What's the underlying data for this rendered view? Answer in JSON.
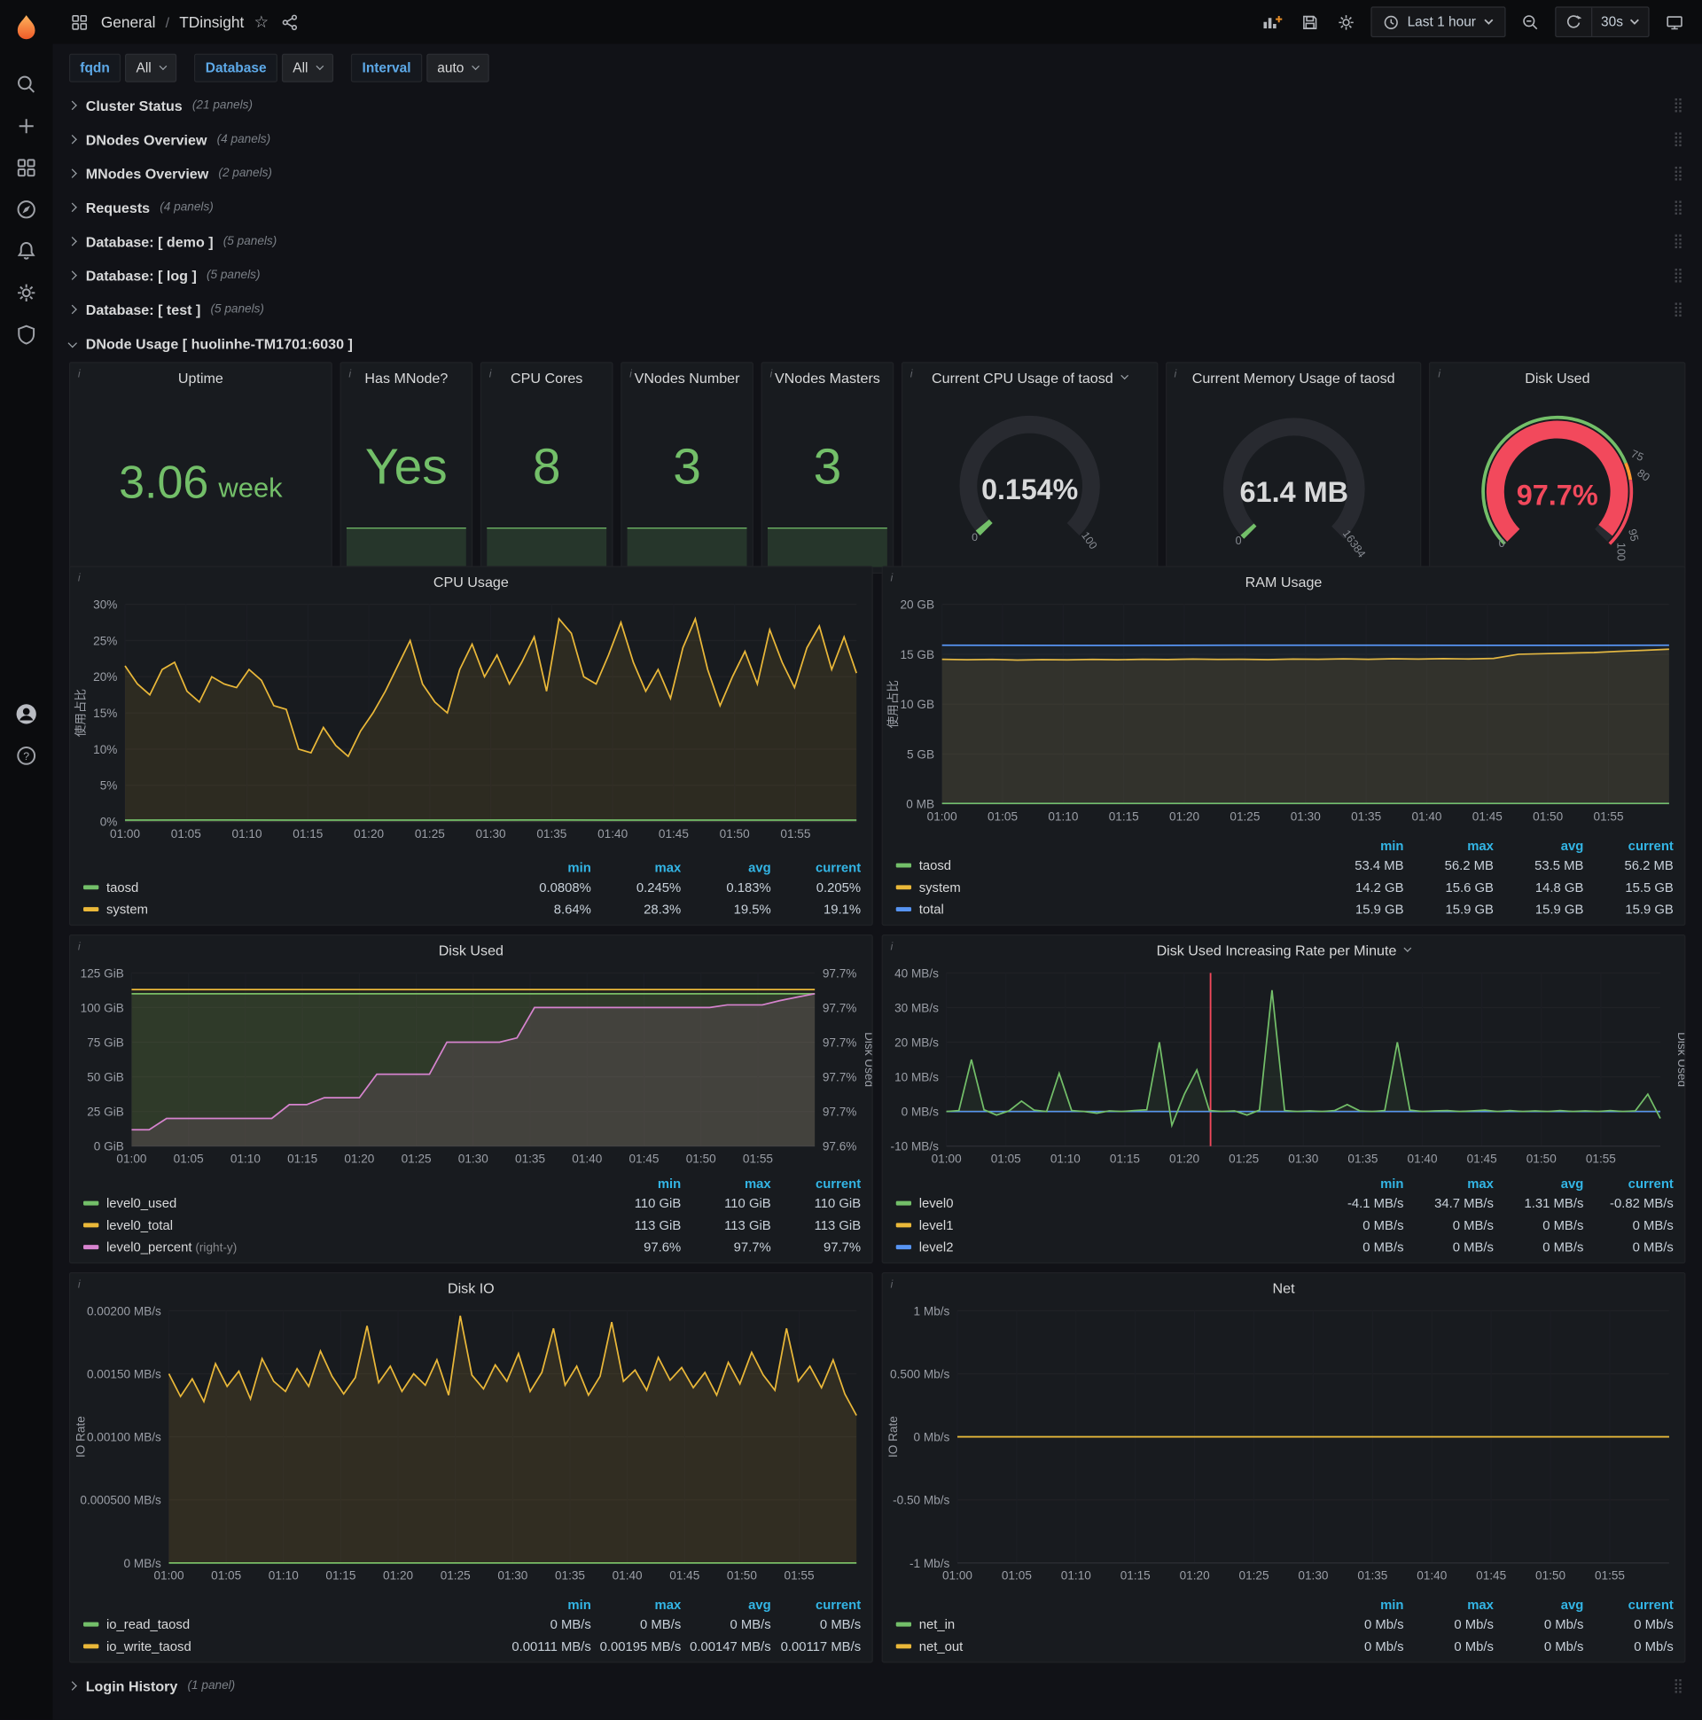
{
  "nav": {
    "breadcrumb_section": "General",
    "breadcrumb_sep": "/",
    "breadcrumb_page": "TDinsight",
    "time_range": "Last 1 hour",
    "refresh_interval": "30s"
  },
  "variables": [
    {
      "label": "fqdn",
      "value": "All"
    },
    {
      "label": "Database",
      "value": "All"
    },
    {
      "label": "Interval",
      "value": "auto"
    }
  ],
  "rows": [
    {
      "title": "Cluster Status",
      "count": "(21 panels)"
    },
    {
      "title": "DNodes Overview",
      "count": "(4 panels)"
    },
    {
      "title": "MNodes Overview",
      "count": "(2 panels)"
    },
    {
      "title": "Requests",
      "count": "(4 panels)"
    },
    {
      "title": "Database: [ demo ]",
      "count": "(5 panels)"
    },
    {
      "title": "Database: [ log ]",
      "count": "(5 panels)"
    },
    {
      "title": "Database: [ test ]",
      "count": "(5 panels)"
    }
  ],
  "expanded_row": {
    "title": "DNode Usage [ huolinhe-TM1701:6030 ]"
  },
  "bottom_row": {
    "title": "Login History",
    "count": "(1 panel)"
  },
  "stats": [
    {
      "title": "Uptime",
      "value": "3.06",
      "unit": "week"
    },
    {
      "title": "Has MNode?",
      "value": "Yes"
    },
    {
      "title": "CPU Cores",
      "value": "8"
    },
    {
      "title": "VNodes Number",
      "value": "3"
    },
    {
      "title": "VNodes Masters",
      "value": "3"
    }
  ],
  "gauges": [
    {
      "title": "Current CPU Usage of taosd",
      "value": "0.154%",
      "pct": 0.02,
      "min": "0",
      "max": "100",
      "color": "#73bf69",
      "value_color": "#d8d9da"
    },
    {
      "title": "Current Memory Usage of taosd",
      "value": "61.4 MB",
      "pct": 0.015,
      "min": "0",
      "max": "16384",
      "color": "#73bf69",
      "value_color": "#d8d9da"
    },
    {
      "title": "Disk Used",
      "value": "97.7%",
      "pct": 0.977,
      "min": "0",
      "color": "#f2495c",
      "value_color": "#f2495c",
      "thresholds": [
        {
          "p": 0.75,
          "label": "75"
        },
        {
          "p": 0.8,
          "label": "80"
        },
        {
          "p": 0.95,
          "label": "95"
        },
        {
          "p": 1.0,
          "label": "100"
        }
      ]
    }
  ],
  "chart_data": [
    {
      "type": "line",
      "title": "CPU Usage",
      "ylabel": "使用占比",
      "ymin": 0,
      "ymax": 30,
      "yticks": [
        {
          "v": 0,
          "label": "0%"
        },
        {
          "v": 5,
          "label": "5%"
        },
        {
          "v": 10,
          "label": "10%"
        },
        {
          "v": 15,
          "label": "15%"
        },
        {
          "v": 20,
          "label": "20%"
        },
        {
          "v": 25,
          "label": "25%"
        },
        {
          "v": 30,
          "label": "30%"
        }
      ],
      "xticks": [
        "01:00",
        "01:05",
        "01:10",
        "01:15",
        "01:20",
        "01:25",
        "01:30",
        "01:35",
        "01:40",
        "01:45",
        "01:50",
        "01:55"
      ],
      "series": [
        {
          "name": "system",
          "color": "#eab839",
          "fill": 0.1,
          "points": [
            21.5,
            19,
            17.5,
            21,
            22,
            18,
            16.5,
            20,
            19,
            18.5,
            21,
            19.5,
            16,
            15.5,
            10,
            9.5,
            13,
            10.5,
            9,
            12.5,
            15,
            18,
            21.5,
            25,
            19,
            16.5,
            15,
            21,
            24.5,
            20,
            23,
            19,
            22,
            25.5,
            18,
            28,
            26,
            20,
            19,
            23,
            27.5,
            22,
            18,
            21,
            17,
            24,
            28,
            21,
            16,
            20,
            23.5,
            19,
            26.5,
            22,
            18.5,
            24,
            27,
            21,
            25.5,
            20.5
          ]
        },
        {
          "name": "taosd",
          "color": "#73bf69",
          "fill": 0,
          "points": [
            0.2,
            0.21,
            0.19,
            0.2,
            0.2,
            0.21,
            0.2,
            0.19,
            0.2,
            0.2
          ]
        }
      ],
      "legend": {
        "headers": [
          "min",
          "max",
          "avg",
          "current"
        ],
        "rows": [
          {
            "name": "taosd",
            "color": "#73bf69",
            "values": [
              "0.0808%",
              "0.245%",
              "0.183%",
              "0.205%"
            ]
          },
          {
            "name": "system",
            "color": "#eab839",
            "values": [
              "8.64%",
              "28.3%",
              "19.5%",
              "19.1%"
            ]
          }
        ]
      }
    },
    {
      "type": "line",
      "title": "RAM Usage",
      "ylabel": "使用占比",
      "ymin": 0,
      "ymax": 20,
      "yticks": [
        {
          "v": 0,
          "label": "0 MB"
        },
        {
          "v": 5,
          "label": "5 GB"
        },
        {
          "v": 10,
          "label": "10 GB"
        },
        {
          "v": 15,
          "label": "15 GB"
        },
        {
          "v": 20,
          "label": "20 GB"
        }
      ],
      "xticks": [
        "01:00",
        "01:05",
        "01:10",
        "01:15",
        "01:20",
        "01:25",
        "01:30",
        "01:35",
        "01:40",
        "01:45",
        "01:50",
        "01:55"
      ],
      "series": [
        {
          "name": "system",
          "color": "#eab839",
          "fill": 0.12,
          "points": [
            14.5,
            14.45,
            14.48,
            14.42,
            14.46,
            14.44,
            14.48,
            14.45,
            14.5,
            14.47,
            14.52,
            14.48,
            14.5,
            14.46,
            14.52,
            14.5,
            14.54,
            14.5,
            14.55,
            14.52,
            14.56,
            14.53,
            14.58,
            15.0,
            15.05,
            15.12,
            15.18,
            15.3,
            15.4,
            15.5
          ]
        },
        {
          "name": "taosd",
          "color": "#73bf69",
          "fill": 0,
          "points": [
            0.05,
            0.05
          ]
        },
        {
          "name": "total",
          "color": "#5794f2",
          "fill": 0.05,
          "points": [
            15.9,
            15.88,
            15.9,
            15.9,
            15.89,
            15.9
          ]
        }
      ],
      "legend": {
        "headers": [
          "min",
          "max",
          "avg",
          "current"
        ],
        "rows": [
          {
            "name": "taosd",
            "color": "#73bf69",
            "values": [
              "53.4 MB",
              "56.2 MB",
              "53.5 MB",
              "56.2 MB"
            ]
          },
          {
            "name": "system",
            "color": "#eab839",
            "values": [
              "14.2 GB",
              "15.6 GB",
              "14.8 GB",
              "15.5 GB"
            ]
          },
          {
            "name": "total",
            "color": "#5794f2",
            "values": [
              "15.9 GB",
              "15.9 GB",
              "15.9 GB",
              "15.9 GB"
            ]
          }
        ]
      }
    },
    {
      "type": "line",
      "title": "Disk Used",
      "ymin": 0,
      "ymax": 125,
      "right_ylabel": "Disk Used",
      "yticks": [
        {
          "v": 0,
          "label": "0 GiB"
        },
        {
          "v": 25,
          "label": "25 GiB"
        },
        {
          "v": 50,
          "label": "50 GiB"
        },
        {
          "v": 75,
          "label": "75 GiB"
        },
        {
          "v": 100,
          "label": "100 GiB"
        },
        {
          "v": 125,
          "label": "125 GiB"
        }
      ],
      "right_yticks": [
        "97.6%",
        "97.7%",
        "97.7%",
        "97.7%",
        "97.7%",
        "97.7%"
      ],
      "xticks": [
        "01:00",
        "01:05",
        "01:10",
        "01:15",
        "01:20",
        "01:25",
        "01:30",
        "01:35",
        "01:40",
        "01:45",
        "01:50",
        "01:55"
      ],
      "series": [
        {
          "name": "level0_used",
          "color": "#73bf69",
          "fill": 0.14,
          "points": [
            110,
            110
          ]
        },
        {
          "name": "level0_total",
          "color": "#eab839",
          "fill": 0.06,
          "points": [
            113,
            113
          ]
        },
        {
          "name": "level0_percent",
          "color": "#d683ce",
          "fill": 0.12,
          "scale": {
            "min": 97.55,
            "max": 97.75
          },
          "points": [
            97.569,
            97.569,
            97.582,
            97.582,
            97.582,
            97.582,
            97.582,
            97.582,
            97.582,
            97.598,
            97.598,
            97.606,
            97.606,
            97.606,
            97.633,
            97.633,
            97.633,
            97.633,
            97.67,
            97.67,
            97.67,
            97.67,
            97.675,
            97.71,
            97.71,
            97.71,
            97.71,
            97.71,
            97.71,
            97.71,
            97.71,
            97.71,
            97.71,
            97.71,
            97.713,
            97.713,
            97.713,
            97.718,
            97.722,
            97.726
          ]
        }
      ],
      "legend": {
        "headers": [
          "min",
          "max",
          "current"
        ],
        "rows": [
          {
            "name": "level0_used",
            "color": "#73bf69",
            "values": [
              "110 GiB",
              "110 GiB",
              "110 GiB"
            ]
          },
          {
            "name": "level0_total",
            "color": "#eab839",
            "values": [
              "113 GiB",
              "113 GiB",
              "113 GiB"
            ]
          },
          {
            "name": "level0_percent",
            "suffix": "(right-y)",
            "color": "#d683ce",
            "values": [
              "97.6%",
              "97.7%",
              "97.7%"
            ]
          }
        ]
      }
    },
    {
      "type": "line",
      "title": "Disk Used Increasing Rate per Minute",
      "ymin": -10,
      "ymax": 40,
      "right_ylabel": "Disk Used",
      "annotation_x": 0.37,
      "yticks": [
        {
          "v": -10,
          "label": "-10 MB/s"
        },
        {
          "v": 0,
          "label": "0 MB/s"
        },
        {
          "v": 10,
          "label": "10 MB/s"
        },
        {
          "v": 20,
          "label": "20 MB/s"
        },
        {
          "v": 30,
          "label": "30 MB/s"
        },
        {
          "v": 40,
          "label": "40 MB/s"
        }
      ],
      "xticks": [
        "01:00",
        "01:05",
        "01:10",
        "01:15",
        "01:20",
        "01:25",
        "01:30",
        "01:35",
        "01:40",
        "01:45",
        "01:50",
        "01:55"
      ],
      "series": [
        {
          "name": "level1",
          "color": "#eab839",
          "fill": 0,
          "points": [
            0,
            0
          ]
        },
        {
          "name": "level2",
          "color": "#5794f2",
          "fill": 0,
          "points": [
            0,
            0
          ]
        },
        {
          "name": "level0",
          "color": "#73bf69",
          "fill": 0.08,
          "points": [
            0,
            0.3,
            15,
            0.5,
            -1,
            0.2,
            3,
            0.4,
            0,
            11,
            0.3,
            0,
            -0.5,
            0.2,
            0,
            0.3,
            0.5,
            20,
            -4,
            5,
            12,
            0.3,
            0,
            0.2,
            -1,
            0.4,
            35,
            0.3,
            0,
            0.2,
            0,
            0.3,
            2,
            0.2,
            0,
            0.3,
            20,
            0.4,
            0,
            0.2,
            0.3,
            0,
            0.2,
            0.4,
            0,
            0.3,
            0,
            0.2,
            0,
            0.3,
            0,
            0.2,
            0,
            0.3,
            0,
            0.2,
            5,
            -2
          ]
        }
      ],
      "legend": {
        "headers": [
          "min",
          "max",
          "avg",
          "current"
        ],
        "rows": [
          {
            "name": "level0",
            "color": "#73bf69",
            "values": [
              "-4.1 MB/s",
              "34.7 MB/s",
              "1.31 MB/s",
              "-0.82 MB/s"
            ]
          },
          {
            "name": "level1",
            "color": "#eab839",
            "values": [
              "0 MB/s",
              "0 MB/s",
              "0 MB/s",
              "0 MB/s"
            ]
          },
          {
            "name": "level2",
            "color": "#5794f2",
            "values": [
              "0 MB/s",
              "0 MB/s",
              "0 MB/s",
              "0 MB/s"
            ]
          }
        ]
      }
    },
    {
      "type": "line",
      "title": "Disk IO",
      "ylabel": "IO Rate",
      "ymin": 0,
      "ymax": 0.002,
      "yticks": [
        {
          "v": 0,
          "label": "0 MB/s"
        },
        {
          "v": 0.0005,
          "label": "0.000500 MB/s"
        },
        {
          "v": 0.001,
          "label": "0.00100 MB/s"
        },
        {
          "v": 0.0015,
          "label": "0.00150 MB/s"
        },
        {
          "v": 0.002,
          "label": "0.00200 MB/s"
        }
      ],
      "xticks": [
        "01:00",
        "01:05",
        "01:10",
        "01:15",
        "01:20",
        "01:25",
        "01:30",
        "01:35",
        "01:40",
        "01:45",
        "01:50",
        "01:55"
      ],
      "series": [
        {
          "name": "io_read_taosd",
          "color": "#73bf69",
          "fill": 0,
          "points": [
            0,
            0
          ]
        },
        {
          "name": "io_write_taosd",
          "color": "#eab839",
          "fill": 0.12,
          "points": [
            0.0015,
            0.00132,
            0.00146,
            0.00128,
            0.00158,
            0.0014,
            0.00152,
            0.0013,
            0.00162,
            0.00144,
            0.00136,
            0.00154,
            0.0014,
            0.00168,
            0.00148,
            0.00134,
            0.00147,
            0.00188,
            0.00143,
            0.00156,
            0.00136,
            0.0015,
            0.00141,
            0.00161,
            0.00133,
            0.00196,
            0.00149,
            0.00138,
            0.00157,
            0.00144,
            0.00166,
            0.00136,
            0.00151,
            0.00186,
            0.00141,
            0.00156,
            0.00133,
            0.00148,
            0.00191,
            0.00144,
            0.00153,
            0.00137,
            0.00163,
            0.00145,
            0.00155,
            0.00139,
            0.00151,
            0.00133,
            0.00159,
            0.00142,
            0.00167,
            0.00149,
            0.00137,
            0.00186,
            0.00144,
            0.00156,
            0.00139,
            0.00161,
            0.00134,
            0.00117
          ]
        }
      ],
      "legend": {
        "headers": [
          "min",
          "max",
          "avg",
          "current"
        ],
        "rows": [
          {
            "name": "io_read_taosd",
            "color": "#73bf69",
            "values": [
              "0 MB/s",
              "0 MB/s",
              "0 MB/s",
              "0 MB/s"
            ]
          },
          {
            "name": "io_write_taosd",
            "color": "#eab839",
            "values": [
              "0.00111 MB/s",
              "0.00195 MB/s",
              "0.00147 MB/s",
              "0.00117 MB/s"
            ]
          }
        ]
      }
    },
    {
      "type": "line",
      "title": "Net",
      "ylabel": "IO Rate",
      "ymin": -1,
      "ymax": 1,
      "yticks": [
        {
          "v": -1,
          "label": "-1 Mb/s"
        },
        {
          "v": -0.5,
          "label": "-0.50 Mb/s"
        },
        {
          "v": 0,
          "label": "0 Mb/s"
        },
        {
          "v": 0.5,
          "label": "0.500 Mb/s"
        },
        {
          "v": 1,
          "label": "1 Mb/s"
        }
      ],
      "xticks": [
        "01:00",
        "01:05",
        "01:10",
        "01:15",
        "01:20",
        "01:25",
        "01:30",
        "01:35",
        "01:40",
        "01:45",
        "01:50",
        "01:55"
      ],
      "series": [
        {
          "name": "net_in",
          "color": "#73bf69",
          "fill": 0,
          "points": [
            0,
            0
          ]
        },
        {
          "name": "net_out",
          "color": "#eab839",
          "fill": 0,
          "points": [
            0,
            0
          ]
        }
      ],
      "legend": {
        "headers": [
          "min",
          "max",
          "avg",
          "current"
        ],
        "rows": [
          {
            "name": "net_in",
            "color": "#73bf69",
            "values": [
              "0 Mb/s",
              "0 Mb/s",
              "0 Mb/s",
              "0 Mb/s"
            ]
          },
          {
            "name": "net_out",
            "color": "#eab839",
            "values": [
              "0 Mb/s",
              "0 Mb/s",
              "0 Mb/s",
              "0 Mb/s"
            ]
          }
        ]
      }
    }
  ]
}
